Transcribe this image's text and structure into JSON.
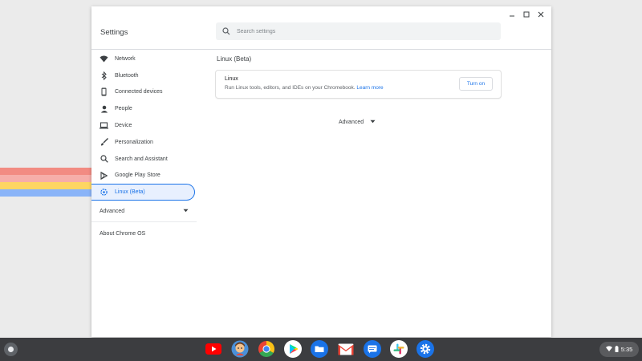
{
  "window": {
    "title": "Settings",
    "controls": [
      "minimize-icon",
      "maximize-icon",
      "close-icon"
    ]
  },
  "search": {
    "placeholder": "Search settings"
  },
  "sidebar": {
    "items": [
      {
        "label": "Network",
        "icon": "wifi-icon"
      },
      {
        "label": "Bluetooth",
        "icon": "bluetooth-icon"
      },
      {
        "label": "Connected devices",
        "icon": "phone-icon"
      },
      {
        "label": "People",
        "icon": "person-icon"
      },
      {
        "label": "Device",
        "icon": "laptop-icon"
      },
      {
        "label": "Personalization",
        "icon": "brush-icon"
      },
      {
        "label": "Search and Assistant",
        "icon": "search-icon"
      },
      {
        "label": "Google Play Store",
        "icon": "play-store-icon"
      },
      {
        "label": "Linux (Beta)",
        "icon": "linux-gear-icon",
        "active": true
      }
    ],
    "advanced_label": "Advanced",
    "about_label": "About Chrome OS"
  },
  "main": {
    "section_title": "Linux (Beta)",
    "card": {
      "title": "Linux",
      "description": "Run Linux tools, editors, and IDEs on your Chromebook.",
      "link_text": "Learn more",
      "button_label": "Turn on"
    },
    "advanced_label": "Advanced"
  },
  "shelf": {
    "apps": [
      "youtube-icon",
      "avatar-app-icon",
      "chrome-icon",
      "play-store-icon",
      "files-icon",
      "gmail-icon",
      "messages-icon",
      "slack-icon",
      "settings-icon"
    ],
    "time": "5:35"
  },
  "colors": {
    "accent": "#1a73e8",
    "active_bg": "#e8f0fe",
    "shelf": "#3c3d40",
    "wallpaper_stripes": [
      "#f28b82",
      "#f6aea9",
      "#fdd663",
      "#8ab4f8"
    ]
  }
}
